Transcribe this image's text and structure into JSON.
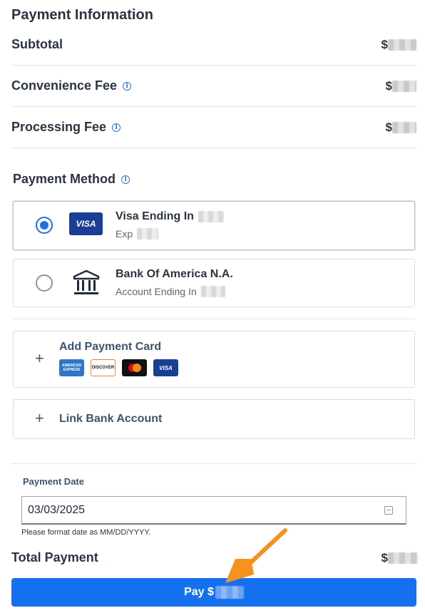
{
  "title": "Payment Information",
  "fees": [
    {
      "label": "Subtotal",
      "currency": "$",
      "has_info": false
    },
    {
      "label": "Convenience Fee",
      "currency": "$",
      "has_info": true
    },
    {
      "label": "Processing Fee",
      "currency": "$",
      "has_info": true
    }
  ],
  "payment_method": {
    "title": "Payment Method",
    "options": [
      {
        "name": "Visa Ending In",
        "sub": "Exp",
        "logo_text": "VISA",
        "selected": true
      },
      {
        "name": "Bank Of America N.A.",
        "sub": "Account Ending In",
        "icon": "bank-icon",
        "selected": false
      }
    ]
  },
  "add_card": {
    "label": "Add Payment Card",
    "brands": [
      "AMERICAN EXPRESS",
      "DISCOVER",
      "mastercard",
      "VISA"
    ]
  },
  "link_bank": {
    "label": "Link Bank Account"
  },
  "payment_date": {
    "label": "Payment Date",
    "value": "03/03/2025",
    "help": "Please format date as MM/DD/YYYY."
  },
  "total": {
    "label": "Total Payment",
    "currency": "$"
  },
  "pay_button": {
    "label": "Pay $"
  },
  "colors": {
    "accent": "#1570ef",
    "visa": "#1a3e96",
    "arrow": "#f5921e"
  }
}
